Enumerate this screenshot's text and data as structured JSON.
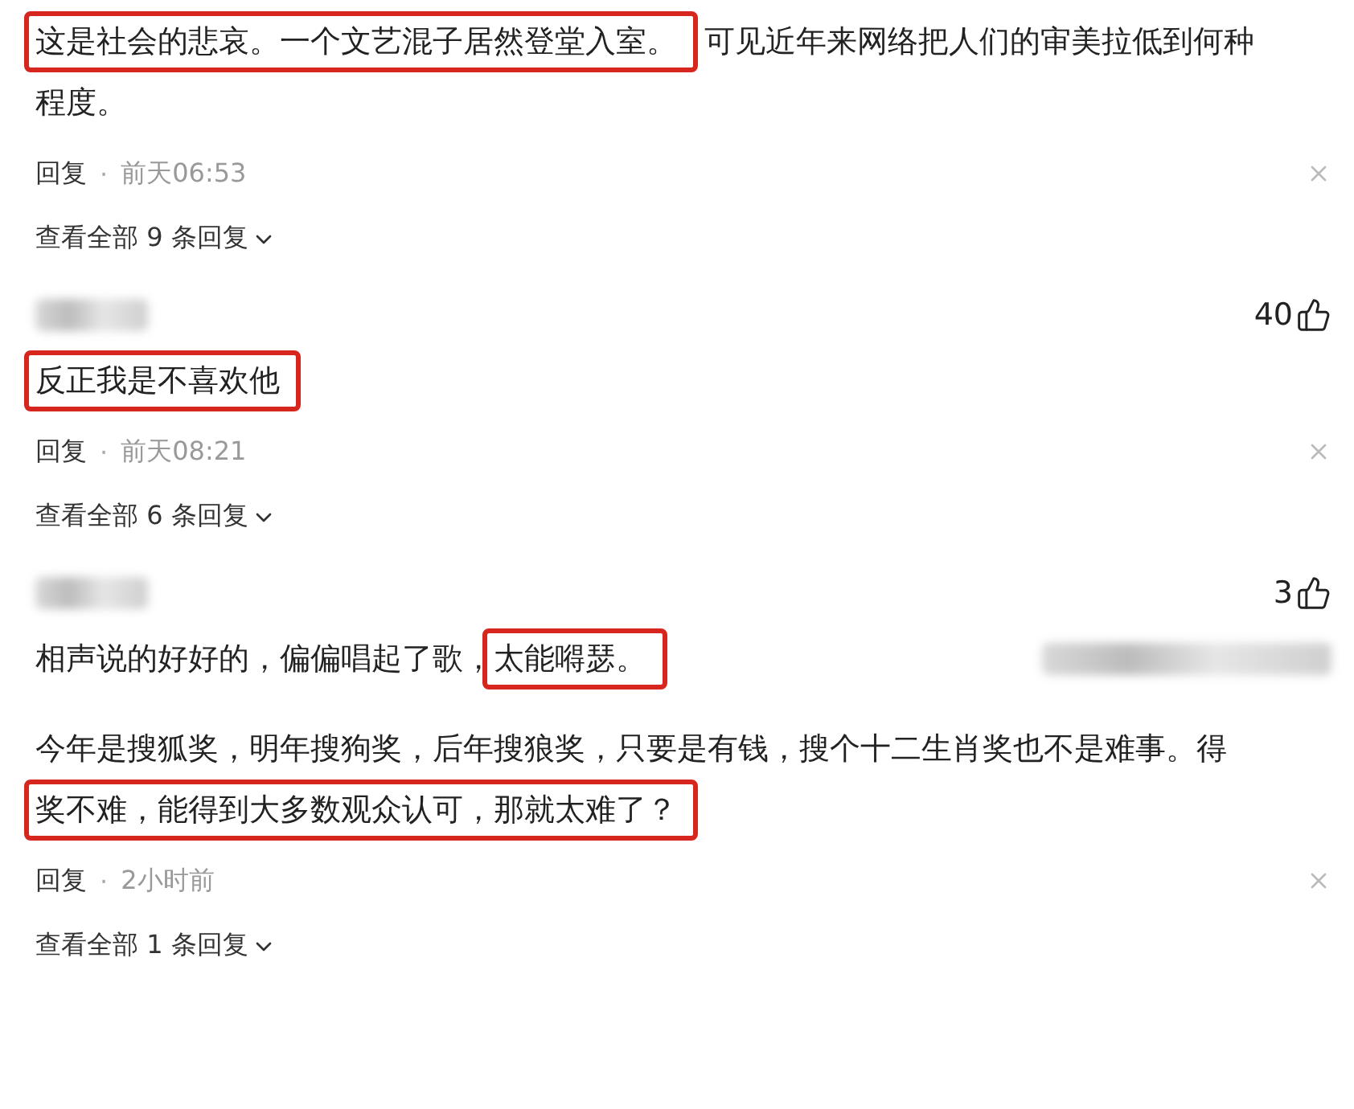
{
  "comments": [
    {
      "lines": [
        [
          {
            "text": "这是社会的悲哀。一个文艺混子居然登堂入室。",
            "highlighted": true
          },
          {
            "text": "可见近年来网络把人们的审美拉低到何种",
            "highlighted": false
          }
        ],
        [
          {
            "text": "程度。",
            "highlighted": false
          }
        ]
      ],
      "reply": "回复",
      "separator": "·",
      "time": "前天06:53",
      "expand": "查看全部 9 条回复"
    },
    {
      "author_blurred": true,
      "likes": "40",
      "lines": [
        [
          {
            "text": "反正我是不喜欢他",
            "highlighted": true
          }
        ]
      ],
      "reply": "回复",
      "separator": "·",
      "time": "前天08:21",
      "expand": "查看全部 6 条回复"
    },
    {
      "author_blurred": true,
      "likes": "3",
      "lines": [
        [
          {
            "text": "相声说的好好的，偏偏唱起了歌，",
            "highlighted": false
          },
          {
            "text": "太能嘚瑟。",
            "highlighted": true
          }
        ]
      ],
      "side_blurred": true
    },
    {
      "lines": [
        [
          {
            "text": "今年是搜狐奖，明年搜狗奖，后年搜狼奖，只要是有钱，搜个十二生肖奖也不是难事。得",
            "highlighted": false
          }
        ],
        [
          {
            "text": "奖不难，能得到大多数观众认可，那就太难了？",
            "highlighted": true
          }
        ]
      ],
      "reply": "回复",
      "separator": "·",
      "time": "2小时前",
      "expand": "查看全部 1 条回复"
    }
  ]
}
